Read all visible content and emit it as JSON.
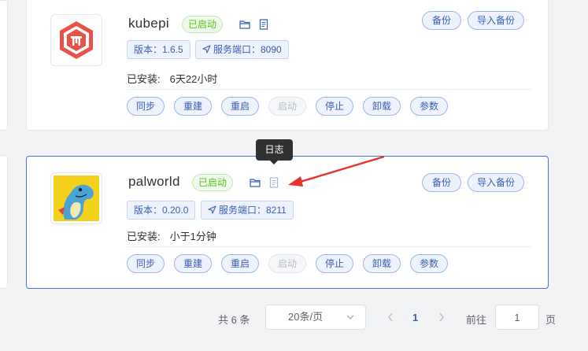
{
  "apps": [
    {
      "name": "kubepi",
      "status": "已启动",
      "version": "版本：1.6.5",
      "port": "服务端口：8090",
      "installed_label": "已安装:",
      "installed_value": "6天22小时"
    },
    {
      "name": "palworld",
      "status": "已启动",
      "version": "版本：0.20.0",
      "port": "服务端口：8211",
      "installed_label": "已安装:",
      "installed_value": "小于1分钟"
    }
  ],
  "actions": {
    "sync": "同步",
    "rebuild": "重建",
    "restart": "重启",
    "start": "启动",
    "stop": "停止",
    "uninstall": "卸载",
    "params": "参数",
    "backup": "备份",
    "import_backup": "导入备份"
  },
  "tooltip": "日志",
  "pagination": {
    "total": "共 6 条",
    "page_size": "20条/页",
    "current_page": "1",
    "goto_label": "前往",
    "goto_value": "1",
    "goto_unit": "页"
  },
  "colors": {
    "accent": "#3a5db5",
    "success": "#52c41a",
    "arrow": "#e8312b"
  }
}
